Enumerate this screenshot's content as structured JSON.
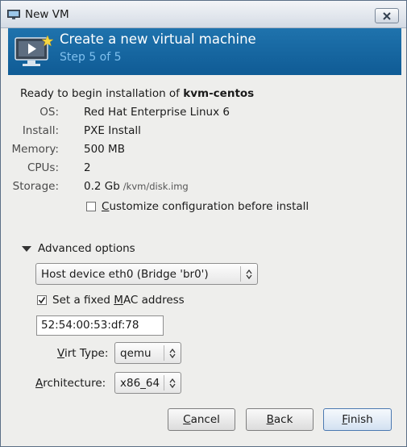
{
  "window": {
    "title": "New VM"
  },
  "header": {
    "title": "Create a new virtual machine",
    "step": "Step 5 of 5"
  },
  "summary": {
    "intro_prefix": "Ready to begin installation of ",
    "vm_name": "kvm-centos",
    "rows": [
      {
        "label": "OS:",
        "value": "Red Hat Enterprise Linux 6",
        "sub": ""
      },
      {
        "label": "Install:",
        "value": "PXE Install",
        "sub": ""
      },
      {
        "label": "Memory:",
        "value": "500 MB",
        "sub": ""
      },
      {
        "label": "CPUs:",
        "value": "2",
        "sub": ""
      },
      {
        "label": "Storage:",
        "value": "0.2 Gb",
        "sub": "/kvm/disk.img"
      }
    ],
    "customize": {
      "mnemonic": "C",
      "rest": "ustomize configuration before install",
      "checked": false
    }
  },
  "advanced": {
    "label": "Advanced options",
    "network": {
      "value": "Host device eth0 (Bridge 'br0')"
    },
    "fixed_mac": {
      "pre": "Set a fixed ",
      "mnemonic": "M",
      "post": "AC address",
      "checked": true
    },
    "mac_value": "52:54:00:53:df:78",
    "virt_type": {
      "mnemonic": "V",
      "rest": "irt Type:",
      "value": "qemu"
    },
    "architecture": {
      "mnemonic": "A",
      "rest": "rchitecture:",
      "value": "x86_64"
    }
  },
  "buttons": {
    "cancel": {
      "mnemonic": "C",
      "rest": "ancel"
    },
    "back": {
      "mnemonic": "B",
      "rest": "ack"
    },
    "finish": {
      "mnemonic": "F",
      "rest": "inish"
    }
  },
  "colors": {
    "banner": "#1667a3",
    "step_text": "#7fc0ee"
  }
}
